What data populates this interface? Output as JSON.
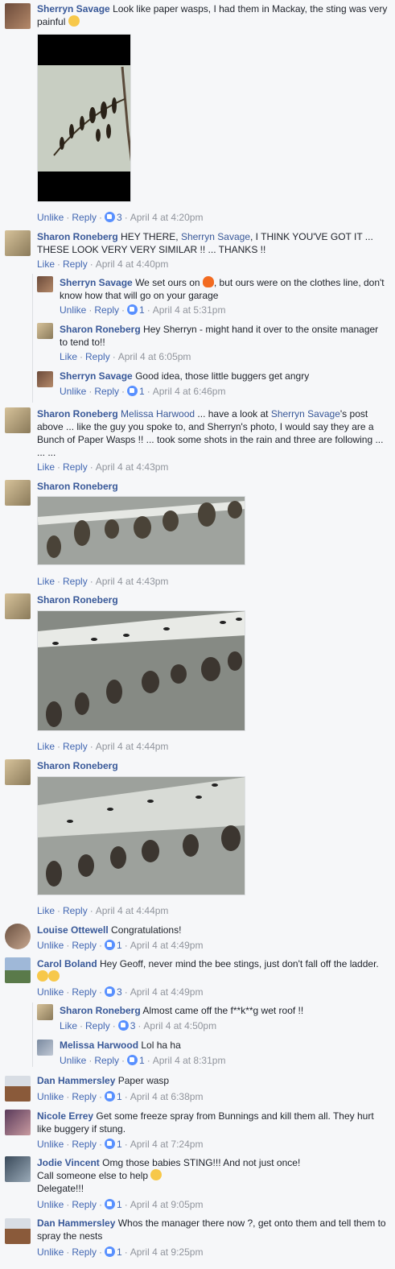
{
  "actions": {
    "unlike": "Unlike",
    "like": "Like",
    "reply": "Reply"
  },
  "comments": [
    {
      "author": "Sherryn Savage",
      "text": "Look like paper wasps, I had them in Mackay, the sting was very painful",
      "likes": "3",
      "time": "April 4 at 4:20pm"
    },
    {
      "author": "Sharon Roneberg",
      "text1": "HEY THERE,",
      "mention": "Sherryn Savage",
      "text2": ", I THINK YOU'VE GOT IT ... THESE LOOK VERY VERY SIMILAR !! ... THANKS !!",
      "time": "April 4 at 4:40pm"
    },
    {
      "author": "Sherryn Savage",
      "text1": "We set ours on",
      "text2": ", but ours were on the clothes line, don't know how that will go on your garage",
      "likes": "1",
      "time": "April 4 at 5:31pm"
    },
    {
      "author": "Sharon Roneberg",
      "text": "Hey Sherryn - might hand it over to the onsite manager to tend to!!",
      "time": "April 4 at 6:05pm"
    },
    {
      "author": "Sherryn Savage",
      "text": "Good idea, those little buggers get angry",
      "likes": "1",
      "time": "April 4 at 6:46pm"
    },
    {
      "author": "Sharon Roneberg",
      "mention1": "Melissa Harwood",
      "text1": "... have a look at",
      "mention2": "Sherryn Savage",
      "text2": "'s post above ... like the guy you spoke to, and Sherryn's photo, I would say they are a Bunch of Paper Wasps !! ... took some shots in the rain and three are following ... ... ...",
      "time": "April 4 at 4:43pm"
    },
    {
      "author": "Sharon Roneberg",
      "time": "April 4 at 4:43pm"
    },
    {
      "author": "Sharon Roneberg",
      "time": "April 4 at 4:44pm"
    },
    {
      "author": "Sharon Roneberg",
      "time": "April 4 at 4:44pm"
    },
    {
      "author": "Louise Ottewell",
      "text": "Congratulations!",
      "likes": "1",
      "time": "April 4 at 4:49pm"
    },
    {
      "author": "Carol Boland",
      "text": "Hey Geoff, never mind the bee stings, just don't fall off the ladder.",
      "likes": "3",
      "time": "April 4 at 4:49pm"
    },
    {
      "author": "Sharon Roneberg",
      "text": "Almost came off the f**k**g wet roof !!",
      "likes": "3",
      "time": "April 4 at 4:50pm"
    },
    {
      "author": "Melissa Harwood",
      "text": "Lol ha ha",
      "likes": "1",
      "time": "April 4 at 8:31pm"
    },
    {
      "author": "Dan Hammersley",
      "text": "Paper wasp",
      "likes": "1",
      "time": "April 4 at 6:38pm"
    },
    {
      "author": "Nicole Errey",
      "text": "Get some freeze spray from Bunnings and kill them all. They hurt like buggery if stung.",
      "likes": "1",
      "time": "April 4 at 7:24pm"
    },
    {
      "author": "Jodie Vincent",
      "text1": "Omg those babies STING!!! And not just once!",
      "text2": "Call someone else to help",
      "text3": "Delegate!!!",
      "likes": "1",
      "time": "April 4 at 9:05pm"
    },
    {
      "author": "Dan Hammersley",
      "text": "Whos the manager there now ?, get onto them and tell them to spray the nests",
      "likes": "1",
      "time": "April 4 at 9:25pm"
    }
  ],
  "colors": {
    "link": "#385898",
    "meta": "#90949c",
    "like_blue": "#5890ff"
  }
}
